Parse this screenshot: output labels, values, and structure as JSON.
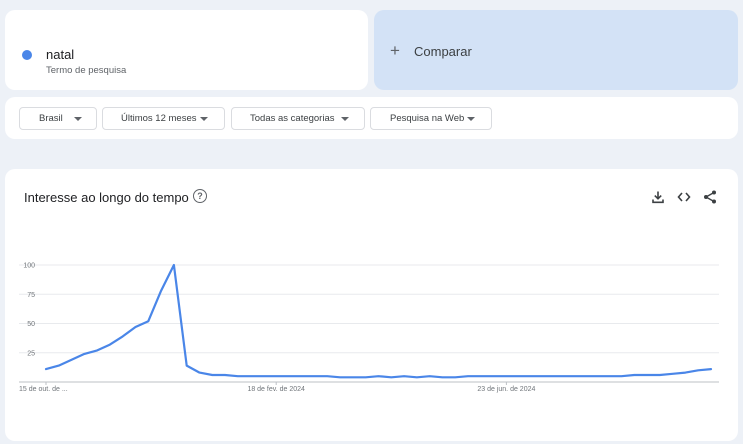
{
  "term": {
    "name": "natal",
    "subtitle": "Termo de pesquisa",
    "color": "#4a86e8"
  },
  "compare": {
    "label": "Comparar"
  },
  "filters": [
    {
      "label": "Brasil"
    },
    {
      "label": "Últimos 12 meses"
    },
    {
      "label": "Todas as categorias"
    },
    {
      "label": "Pesquisa na Web"
    }
  ],
  "chart_section": {
    "title": "Interesse ao longo do tempo",
    "icons": [
      "help-icon",
      "download-icon",
      "embed-code-icon",
      "share-icon"
    ]
  },
  "chart_data": {
    "type": "line",
    "title": "Interesse ao longo do tempo",
    "xlabel": "",
    "ylabel": "",
    "ylim": [
      0,
      100
    ],
    "yticks": [
      25,
      50,
      75,
      100
    ],
    "grid": true,
    "x_tick_labels": [
      {
        "index": 0,
        "label": "15 de out. de ..."
      },
      {
        "index": 18,
        "label": "18 de fev. de 2024"
      },
      {
        "index": 36,
        "label": "23 de jun. de 2024"
      }
    ],
    "series": [
      {
        "color": "#4a86e8",
        "values": [
          11,
          14,
          19,
          24,
          27,
          32,
          39,
          47,
          52,
          78,
          100,
          14,
          8,
          6,
          6,
          5,
          5,
          5,
          5,
          5,
          5,
          5,
          5,
          4,
          4,
          4,
          5,
          4,
          5,
          4,
          5,
          4,
          4,
          5,
          5,
          5,
          5,
          5,
          5,
          5,
          5,
          5,
          5,
          5,
          5,
          5,
          6,
          6,
          6,
          7,
          8,
          10,
          11
        ]
      }
    ]
  }
}
